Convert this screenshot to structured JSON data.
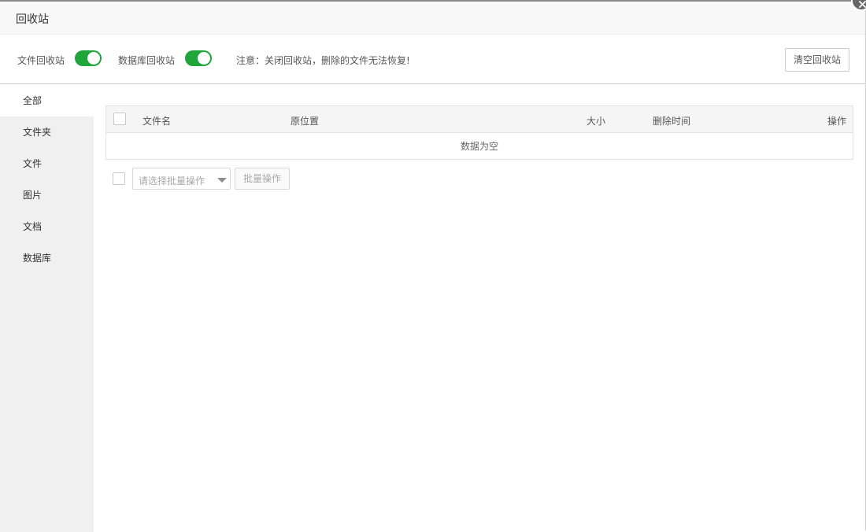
{
  "dialog": {
    "title": "回收站"
  },
  "toolbar": {
    "file_recycle_label": "文件回收站",
    "file_recycle_enabled": true,
    "db_recycle_label": "数据库回收站",
    "db_recycle_enabled": true,
    "note": "注意：关闭回收站，删除的文件无法恢复!",
    "clear_button": "清空回收站",
    "toggle_color": "#20a53a"
  },
  "sidebar": {
    "items": [
      {
        "label": "全部",
        "active": true
      },
      {
        "label": "文件夹"
      },
      {
        "label": "文件"
      },
      {
        "label": "图片"
      },
      {
        "label": "文档"
      },
      {
        "label": "数据库"
      }
    ]
  },
  "table": {
    "columns": {
      "name": "文件名",
      "location": "原位置",
      "size": "大小",
      "deleted_time": "删除时间",
      "actions": "操作"
    },
    "empty_text": "数据为空"
  },
  "batch": {
    "select_placeholder": "请选择批量操作",
    "button": "批量操作"
  }
}
